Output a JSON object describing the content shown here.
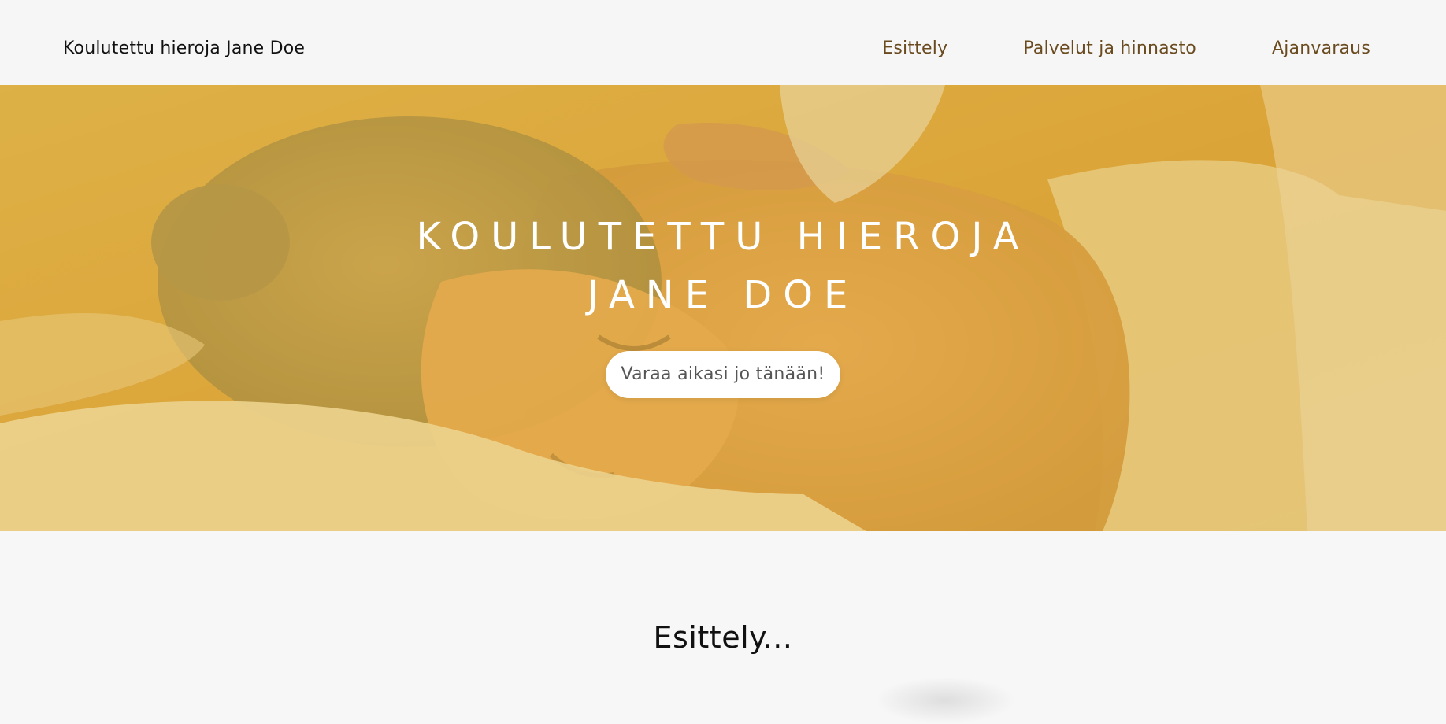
{
  "header": {
    "brand": "Koulutettu hieroja Jane Doe",
    "nav": [
      {
        "label": "Esittely"
      },
      {
        "label": "Palvelut ja hinnasto"
      },
      {
        "label": "Ajanvaraus"
      }
    ]
  },
  "hero": {
    "title_line1": "KOULUTETTU HIEROJA",
    "title_line2": "JANE DOE",
    "cta_label": "Varaa aikasi jo tänään!"
  },
  "intro": {
    "heading": "Esittely..."
  },
  "colors": {
    "accent": "#6a4b1f",
    "overlay": "#e8b634",
    "background": "#f7f7f7"
  }
}
